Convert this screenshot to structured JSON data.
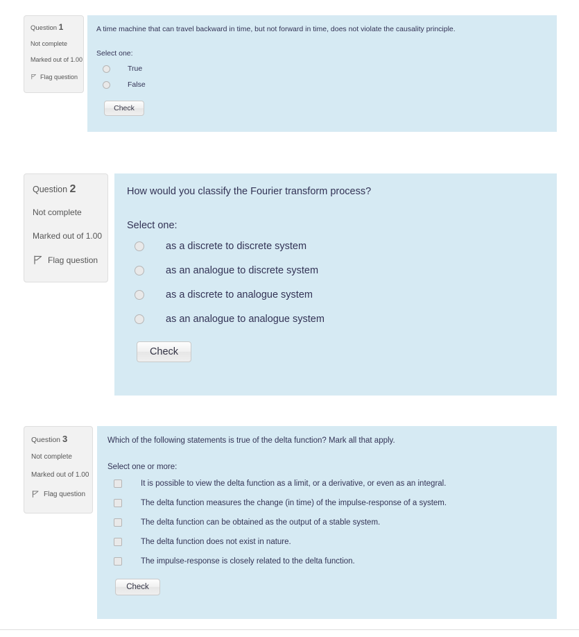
{
  "theme": {
    "panel_bg": "#d6eaf3",
    "info_bg": "#f2f2f2",
    "info_border": "#dedede",
    "text_color": "#333355",
    "muted_text": "#555555"
  },
  "questions": [
    {
      "number_label": "Question",
      "number": "1",
      "state": "Not complete",
      "marked_out_of": "Marked out of 1.00",
      "flag_label": "Flag question",
      "flag_icon": "flag-icon",
      "question_text": "A time machine that can travel backward in time, but not forward in time, does not violate the causality principle.",
      "select_label": "Select one:",
      "input_type": "radio",
      "options": [
        "True",
        "False"
      ],
      "check_label": "Check"
    },
    {
      "number_label": "Question",
      "number": "2",
      "state": "Not complete",
      "marked_out_of": "Marked out of 1.00",
      "flag_label": "Flag question",
      "flag_icon": "flag-icon",
      "question_text": "How would you classify the Fourier transform process?",
      "select_label": "Select one:",
      "input_type": "radio",
      "options": [
        "as a discrete to discrete system",
        "as an analogue to discrete system",
        "as a discrete to analogue system",
        "as an analogue to analogue system"
      ],
      "check_label": "Check"
    },
    {
      "number_label": "Question",
      "number": "3",
      "state": "Not complete",
      "marked_out_of": "Marked out of 1.00",
      "flag_label": "Flag question",
      "flag_icon": "flag-icon",
      "question_text": "Which of the following statements is true of the delta function? Mark all that apply.",
      "select_label": "Select one or more:",
      "input_type": "checkbox",
      "options": [
        "It is possible to view the delta function as a limit, or a derivative, or even as an integral.",
        "The delta function measures the change (in time) of the impulse-response of a system.",
        "The delta function can be obtained as the output of a stable system.",
        "The delta function does not exist in nature.",
        "The impulse-response is closely related to the delta function."
      ],
      "check_label": "Check"
    }
  ]
}
